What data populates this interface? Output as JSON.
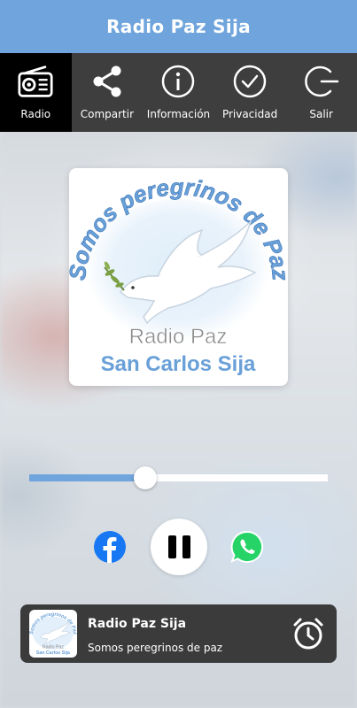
{
  "header": {
    "title": "Radio Paz Sija"
  },
  "nav": {
    "items": [
      {
        "label": "Radio",
        "icon": "radio-icon",
        "active": true
      },
      {
        "label": "Compartir",
        "icon": "share-icon",
        "active": false
      },
      {
        "label": "Información",
        "icon": "info-icon",
        "active": false
      },
      {
        "label": "Privacidad",
        "icon": "check-circle-icon",
        "active": false
      },
      {
        "label": "Salir",
        "icon": "exit-icon",
        "active": false
      }
    ]
  },
  "cover": {
    "arc_text": "Somos peregrinos de Paz",
    "line1": "Radio Paz",
    "line2": "San Carlos Sija"
  },
  "player": {
    "volume": 0.39,
    "state": "playing",
    "buttons": [
      "facebook-icon",
      "pause-icon",
      "whatsapp-icon"
    ]
  },
  "mini_player": {
    "title": "Radio Paz Sija",
    "subtitle": "Somos peregrinos de paz",
    "thumb_arc_text": "Somos peregrinos de Paz",
    "thumb_line1": "Radio Paz",
    "thumb_line2": "San Carlos Sija"
  },
  "colors": {
    "accent": "#6fa4dc",
    "nav_bg": "#3e3e3e",
    "nav_active": "#000000",
    "facebook": "#1877f2",
    "whatsapp": "#25d366",
    "logo_text": "#6aa0d8"
  }
}
